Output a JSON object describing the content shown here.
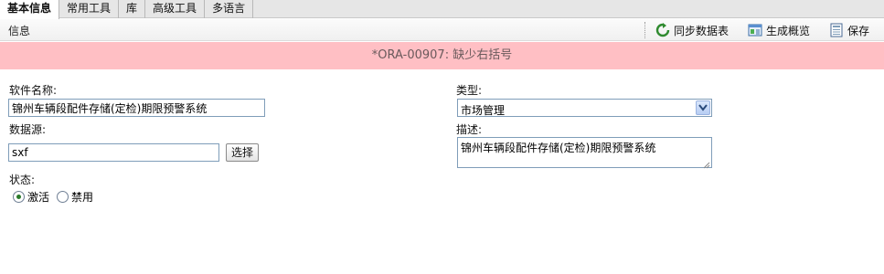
{
  "tabs": [
    {
      "label": "基本信息",
      "active": true
    },
    {
      "label": "常用工具",
      "active": false
    },
    {
      "label": "库",
      "active": false
    },
    {
      "label": "高级工具",
      "active": false
    },
    {
      "label": "多语言",
      "active": false
    }
  ],
  "toolbar": {
    "title": "信息",
    "sync_label": "同步数据表",
    "generate_label": "生成概览",
    "save_label": "保存"
  },
  "error": {
    "message": "*ORA-00907: 缺少右括号"
  },
  "form": {
    "software_name_label": "软件名称:",
    "software_name_value": "锦州车辆段配件存储(定检)期限预警系统",
    "type_label": "类型:",
    "type_value": "市场管理",
    "datasource_label": "数据源:",
    "datasource_value": "sxf",
    "select_button": "选择",
    "description_label": "描述:",
    "description_value": "锦州车辆段配件存储(定检)期限预警系统",
    "status_label": "状态:",
    "status_options": [
      {
        "label": "激活",
        "checked": true
      },
      {
        "label": "禁用",
        "checked": false
      }
    ]
  },
  "colors": {
    "error_bg": "#ffbfc4",
    "error_text": "#6a5a5c",
    "tab_bg": "#e6e6e6",
    "input_border": "#7f9db9"
  }
}
